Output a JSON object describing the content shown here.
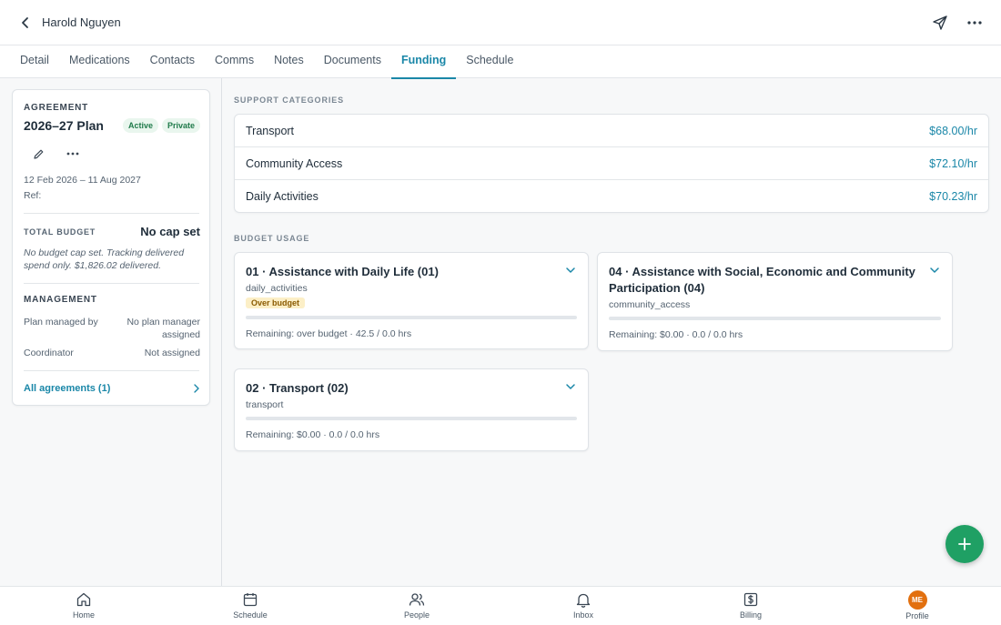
{
  "header": {
    "title": "Harold Nguyen"
  },
  "tabs": [
    {
      "label": "Detail"
    },
    {
      "label": "Medications"
    },
    {
      "label": "Contacts"
    },
    {
      "label": "Comms"
    },
    {
      "label": "Notes"
    },
    {
      "label": "Documents"
    },
    {
      "label": "Funding",
      "active": true
    },
    {
      "label": "Schedule"
    }
  ],
  "agreement": {
    "eyebrow": "AGREEMENT",
    "title": "2026–27 Plan",
    "badges": [
      "Active",
      "Private"
    ],
    "date_range": "12 Feb 2026 – 11 Aug 2027",
    "ref": "Ref:",
    "total_budget_label": "TOTAL BUDGET",
    "total_budget_value": "No cap set",
    "budget_note": "No budget cap set. Tracking delivered spend only. $1,826.02 delivered.",
    "management_label": "MANAGEMENT",
    "plan_managed_by_label": "Plan managed by",
    "plan_managed_by_value": "No plan manager assigned",
    "coordinator_label": "Coordinator",
    "coordinator_value": "Not assigned",
    "all_agreements": "All agreements (1)"
  },
  "support_categories": {
    "label": "SUPPORT CATEGORIES",
    "items": [
      {
        "name": "Transport",
        "rate": "$68.00/hr"
      },
      {
        "name": "Community Access",
        "rate": "$72.10/hr"
      },
      {
        "name": "Daily Activities",
        "rate": "$70.23/hr"
      }
    ]
  },
  "budget_usage": {
    "label": "BUDGET USAGE",
    "items": [
      {
        "title": "01 · Assistance with Daily Life (01)",
        "code": "daily_activities",
        "badge": "Over budget",
        "meta": "Remaining: over budget · 42.5 / 0.0 hrs",
        "progress": 0
      },
      {
        "title": "04 · Assistance with Social, Economic and Community Participation (04)",
        "code": "community_access",
        "meta": "Remaining: $0.00 · 0.0 / 0.0 hrs",
        "progress": 0
      },
      {
        "title": "02 · Transport (02)",
        "code": "transport",
        "meta": "Remaining: $0.00 · 0.0 / 0.0 hrs",
        "progress": 0
      }
    ]
  },
  "bottom_nav": [
    {
      "label": "Home",
      "icon": "home-icon"
    },
    {
      "label": "Schedule",
      "icon": "calendar-icon"
    },
    {
      "label": "People",
      "icon": "people-icon"
    },
    {
      "label": "Inbox",
      "icon": "bell-icon"
    },
    {
      "label": "Billing",
      "icon": "dollar-icon"
    },
    {
      "label": "Profile",
      "icon": "avatar",
      "initials": "ME"
    }
  ],
  "colors": {
    "accent": "#1a87a8",
    "fab": "#1fa064",
    "avatar": "#e2700f",
    "badge_green_bg": "#e9f6ee",
    "badge_over_bg": "#fcefc7"
  }
}
